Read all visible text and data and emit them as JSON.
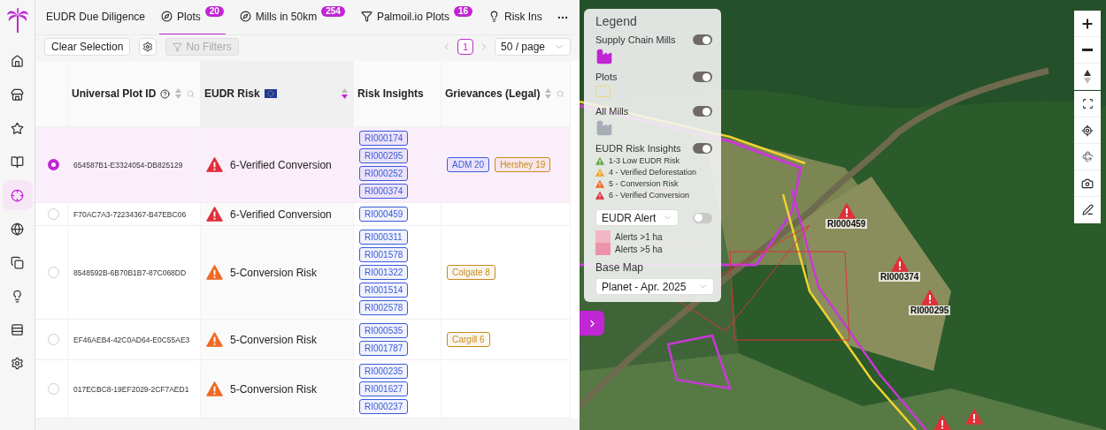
{
  "nav": [
    {
      "selected": false
    },
    {
      "selected": false
    },
    {
      "selected": false
    },
    {
      "selected": false
    },
    {
      "selected": true
    },
    {
      "selected": false
    },
    {
      "selected": false
    },
    {
      "selected": false
    },
    {
      "selected": false
    },
    {
      "selected": false
    }
  ],
  "tabs": [
    {
      "label": "EUDR Due Diligence",
      "selected": false
    },
    {
      "label": "Plots",
      "count": "20",
      "selected": true
    },
    {
      "label": "Mills in 50km",
      "count": "254",
      "selected": false
    },
    {
      "label": "Palmoil.io Plots",
      "count": "16",
      "selected": false
    },
    {
      "label": "Risk Ins",
      "selected": false
    }
  ],
  "toolbar": {
    "clear_button": "Clear Selection",
    "filter_button": {
      "label": "No Filters",
      "disabled": true
    },
    "page": "1",
    "page_size": "50 / page"
  },
  "table": {
    "columns": [
      {
        "label": "Universal Plot ID",
        "sorted": false
      },
      {
        "label": "EUDR Risk",
        "sorted": true
      },
      {
        "label": "Risk Insights",
        "sorted": false
      },
      {
        "label": "Grievances (Legal)",
        "sorted": false
      }
    ],
    "rows": [
      {
        "selected": true,
        "plot_id": "654587B1-E3324054-DB825129",
        "risk": {
          "label": "6-Verified Conversion",
          "color": "#e0303a"
        },
        "insights": [
          "RI000174",
          "RI000295",
          "RI000252",
          "RI000374"
        ],
        "grievances": [
          {
            "label": "ADM 20",
            "color": "#3a5bd9"
          },
          {
            "label": "Hershey 19",
            "color": "#c98a1e"
          }
        ]
      },
      {
        "selected": false,
        "plot_id": "F70AC7A3-72234367-B47EBC06",
        "risk": {
          "label": "6-Verified Conversion",
          "color": "#e0303a"
        },
        "insights": [
          "RI000459"
        ],
        "grievances": []
      },
      {
        "selected": false,
        "plot_id": "8548592B-6B70B1B7-87C068DD",
        "risk": {
          "label": "5-Conversion Risk",
          "color": "#ee6a24"
        },
        "insights": [
          "RI000311",
          "RI001578",
          "RI001322",
          "RI001514",
          "RI002578"
        ],
        "grievances": [
          {
            "label": "Colgate 8",
            "color": "#c98a1e"
          }
        ]
      },
      {
        "selected": false,
        "plot_id": "EF46AEB4-42C0AD64-E0C55AE3",
        "risk": {
          "label": "5-Conversion Risk",
          "color": "#ee6a24"
        },
        "insights": [
          "RI000535",
          "RI001787"
        ],
        "grievances": [
          {
            "label": "Cargill 6",
            "color": "#c98a1e"
          }
        ]
      },
      {
        "selected": false,
        "plot_id": "017ECBC8-19EF2029-2CF7AED1",
        "risk": {
          "label": "5-Conversion Risk",
          "color": "#ee6a24"
        },
        "insights": [
          "RI000235",
          "RI001627",
          "RI000237"
        ],
        "grievances": []
      }
    ]
  },
  "legend": {
    "title": "Legend",
    "layers": [
      {
        "label": "Supply Chain Mills",
        "on": true,
        "kind": "supply"
      },
      {
        "label": "Plots",
        "on": true,
        "kind": "plots"
      },
      {
        "label": "All Mills",
        "on": true,
        "kind": "mills"
      },
      {
        "label": "EUDR Risk Insights",
        "on": true,
        "kind": "risk"
      }
    ],
    "risk_items": [
      {
        "label": "1-3 Low EUDR Risk",
        "color": "#6aa84f"
      },
      {
        "label": "4 - Verified Deforestation",
        "color": "#f1a62b"
      },
      {
        "label": "5 - Conversion Risk",
        "color": "#ee6a24"
      },
      {
        "label": "6 - Verified Conversion",
        "color": "#e0303a"
      }
    ],
    "alert": {
      "label": "EUDR Alert",
      "on": false
    },
    "alert_levels": [
      {
        "label": "Alerts >1 ha",
        "color": "#f2b5c3"
      },
      {
        "label": "Alerts >5 ha",
        "color": "#ec93ab"
      }
    ],
    "base_map_label": "Base Map",
    "base_map": "Planet - Apr. 2025"
  },
  "map": {
    "markers": [
      {
        "label": "RI000459"
      },
      {
        "label": "RI000374"
      },
      {
        "label": "RI000295"
      }
    ]
  }
}
